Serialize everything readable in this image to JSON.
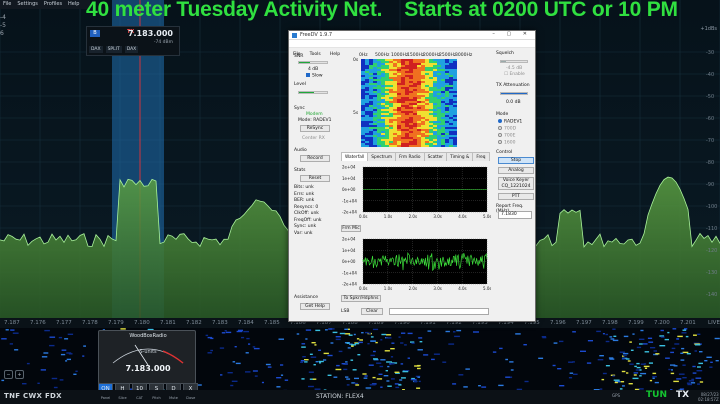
{
  "banner": {
    "left": "40 meter Tuesday Activity Net.",
    "right": "Starts at 0200 UTC or 10 PM"
  },
  "sdr_menu": [
    "File",
    "Settings",
    "Profiles",
    "Help"
  ],
  "slice": {
    "frequency": "7.183.000",
    "rx_letter": "B",
    "tx_label": "TX",
    "dbm": "-74 dBm",
    "buttons": [
      "DAX",
      "SPLIT",
      "DAX"
    ],
    "left_values": [
      "-4",
      "-5",
      "6"
    ]
  },
  "pan_right_top": "+1dBs",
  "pan_y_labels": [
    "-30",
    "-40",
    "-50",
    "-60",
    "-70",
    "-80",
    "-90",
    "-100",
    "-110",
    "-120",
    "-130",
    "-140"
  ],
  "freq_scale": [
    "7.187",
    "7.176",
    "7.177",
    "7.178",
    "7.179",
    "7.180",
    "7.181",
    "7.182",
    "7.183",
    "7.184",
    "7.185",
    "7.186",
    "7.187",
    "7.188",
    "7.189",
    "7.190",
    "7.191",
    "7.192",
    "7.193",
    "7.194",
    "7.195",
    "7.196",
    "7.197",
    "7.198",
    "7.199",
    "7.200",
    "7.201"
  ],
  "freq_scale_end": "LIVE",
  "meter": {
    "title": "WoodBoxRadio",
    "smeter": "S-units",
    "freq": "7.183.000",
    "buttons": [
      "ON",
      "H",
      "10",
      "S",
      "D",
      "X"
    ],
    "labels": [
      "Panel",
      "Slice",
      "CAT",
      "Pitch",
      "Mute",
      "Close"
    ]
  },
  "status": {
    "left": "TNF  CWX  FDX",
    "station": "STATION: FLEX4",
    "tun": "TUN",
    "tx": "TX",
    "gps": "GPS",
    "clock_date": "08/27/23",
    "clock_time": "02:18:57Z"
  },
  "freedv": {
    "title": "FreeDV 1.9.7",
    "menu": [
      "File",
      "Tools",
      "Help"
    ],
    "snr_label": "SNR",
    "snr_value": "4 dB",
    "slow_label": "Slow",
    "level_label": "Level",
    "sync_label": "Sync",
    "sync_value": "Modem",
    "mode_label": "Mode: RADEV1",
    "resync": "ReSync",
    "center_rx": "Center RX",
    "audio_label": "Audio",
    "record": "Record",
    "stats_label": "Stats",
    "reset": "Reset",
    "stats": [
      "Bits: unk",
      "Errs: unk",
      "BER: unk",
      "Resyncs: 0",
      "ClkOff: unk",
      "FreqOff: unk",
      "Sync: unk",
      "Var: unk"
    ],
    "assistance": "Assistance",
    "get_help": "Get Help",
    "freq_axis": [
      "0Hz",
      "500Hz",
      "1000Hz",
      "1500Hz",
      "2000Hz",
      "2500Hz",
      "3000Hz"
    ],
    "time_axis": [
      "0s",
      "5s"
    ],
    "tabs": [
      "Waterfall",
      "Spectrum",
      "Frm Radio",
      "Scatter",
      "Timing &",
      "Freq"
    ],
    "chart1_x": [
      "0.0s",
      "1.0s",
      "2.0s",
      "3.0s",
      "4.0s",
      "5.0s"
    ],
    "chart1_y": [
      "2e+04",
      "1e+04",
      "0e+00",
      "-1e+04",
      "-2e+04"
    ],
    "frm_mic": "Frm Mic",
    "chart2_x": [
      "0.0s",
      "1.0s",
      "2.0s",
      "3.0s",
      "4.0s",
      "5.0s"
    ],
    "chart2_y": [
      "2e+04",
      "1e+04",
      "0e+00",
      "-1e+04",
      "-2e+04"
    ],
    "to_spkr": "To Spkr/Hdphns",
    "lsb_label": "LSB",
    "clear": "Clear",
    "squelch_label": "Squelch",
    "squelch_value": "-4.5 dB",
    "enable": "Enable",
    "tx_att_label": "TX Attenuation",
    "tx_att_value": "0.0 dB",
    "mode_label2": "Mode",
    "modes": [
      "RADEV1",
      "700D",
      "700E",
      "1600"
    ],
    "control_label": "Control",
    "stop": "Stop",
    "analog": "Analog",
    "voice_keyer": "Voice Keyer",
    "vk_file": "CQ_1221024",
    "ptt": "PTT",
    "report_label": "Report Freq. (MHz)",
    "report_value": "7.1830"
  },
  "colors": {
    "banner": "#30e040",
    "pan_fill": "#3f7f2f",
    "slice_band": "#1f6fb0",
    "tun": "#14c430",
    "meter_on": "#1d6fd6"
  }
}
